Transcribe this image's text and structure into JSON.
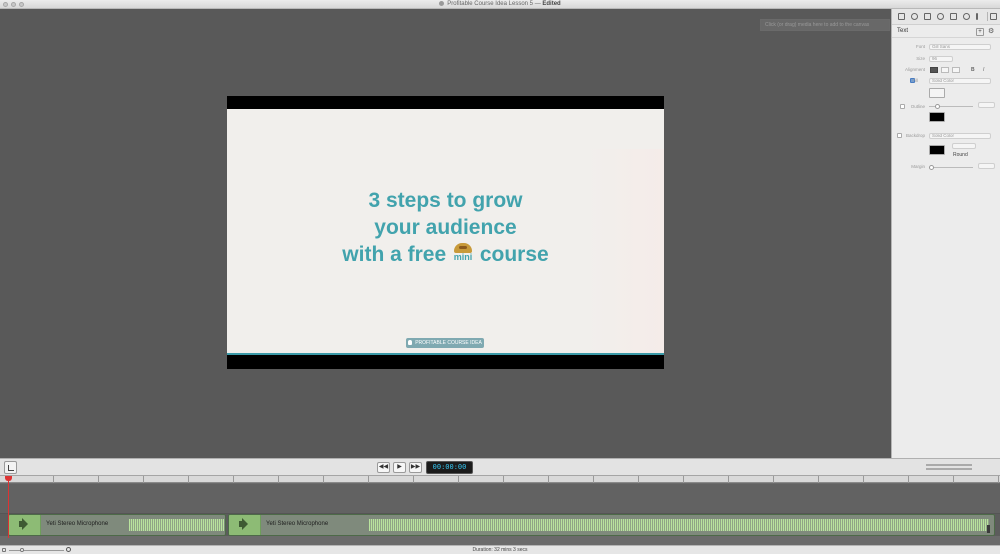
{
  "window": {
    "title": "Profitable Course Idea Lesson 5",
    "separator": "—",
    "status": "Edited",
    "tooltip": "Click (or drag) media here to add to the canvas"
  },
  "slide": {
    "line1": "3 steps to grow",
    "line2": "your audience",
    "line3_before": "with a free",
    "mini": "mini",
    "line3_after": "course",
    "badge": "PROFITABLE COURSE IDEA",
    "heading_color": "#42a3ad",
    "accent_color": "#3b9aa8"
  },
  "inspector": {
    "title": "Text",
    "plus_label": "+",
    "gear_label": "⚙",
    "font_label": "Font",
    "font_value": "Gill Sans",
    "size_label": "Size",
    "size_value": "96",
    "alignment_label": "Alignment",
    "bold_label": "B",
    "italic_label": "I",
    "fill_label": "Fill",
    "fill_value": "Solid Color",
    "outline_label": "Outline",
    "backdrop_label": "Backdrop",
    "backdrop_value": "Solid Color",
    "round_label": "Round",
    "margin_label": "Margin"
  },
  "transport": {
    "rewind_label": "◀◀",
    "play_label": "▶",
    "forward_label": "▶▶",
    "timecode": "00:00:00"
  },
  "timeline": {
    "tracks": [
      {
        "label": "Yeti Stereo Microphone"
      },
      {
        "label": "Yeti Stereo Microphone"
      }
    ]
  },
  "status": {
    "duration": "Duration: 32 mins 3 secs"
  }
}
